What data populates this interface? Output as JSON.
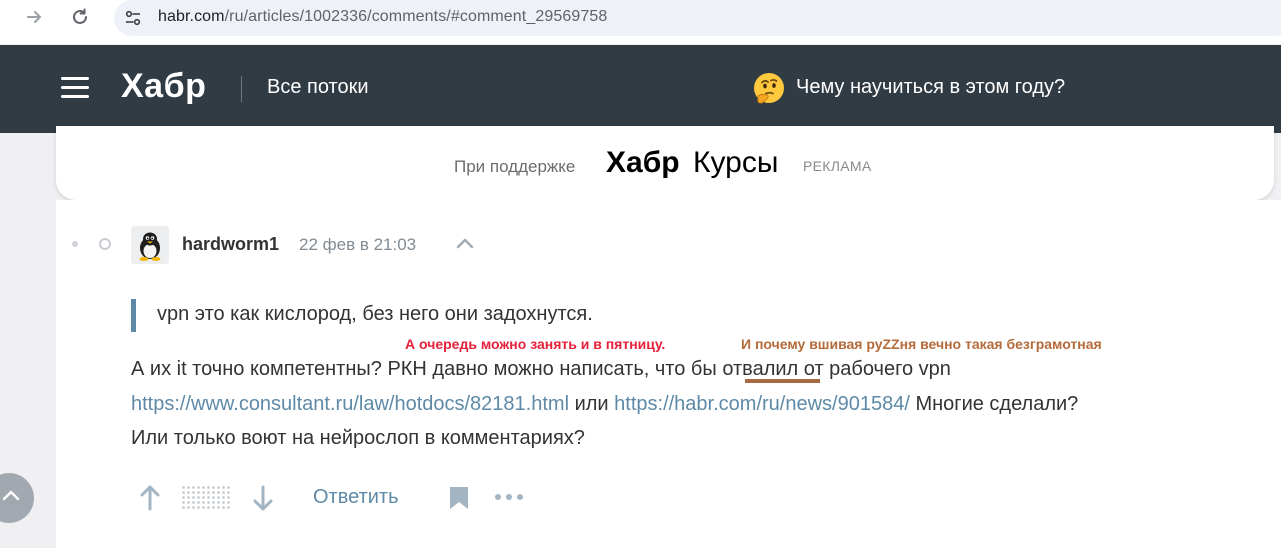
{
  "browser": {
    "url_host": "habr.com",
    "url_path": "/ru/articles/1002336/comments/#comment_29569758"
  },
  "header": {
    "logo": "Хабр",
    "all_streams": "Все потоки",
    "promo": "Чему научиться в этом году?",
    "promo_icon": "thinking-face-icon"
  },
  "sponsor": {
    "label": "При поддержке",
    "brand_bold": "Хабр",
    "brand_light": "Курсы",
    "ad_label": "РЕКЛАМА"
  },
  "comment": {
    "author": "hardworm1",
    "time": "22 фев в 21:03",
    "quote": "vpn это как кислород, без него они задохнутся.",
    "line1_a": "А их it точно компетентны? РКН давно можно написать, ",
    "line1_b": "что бы",
    "line1_c": " отвалил от рабочего vpn",
    "link1": "https://www.consultant.ru/law/hotdocs/82181.html",
    "line2_mid": " или ",
    "link2": "https://habr.com/ru/news/901584/",
    "line2_end": " Многие сделали?",
    "line3": "Или только воют на нейрослоп в комментариях?",
    "annotation_red": "А очередь можно занять и в пятницу.",
    "annotation_brown": "И почему вшивая руZZня вечно такая безграмотная"
  },
  "actions": {
    "reply": "Ответить"
  },
  "colors": {
    "header_bg": "#303b44",
    "link": "#5e8aa7",
    "annotation_red": "#e5203a",
    "annotation_brown": "#b56a3a"
  }
}
